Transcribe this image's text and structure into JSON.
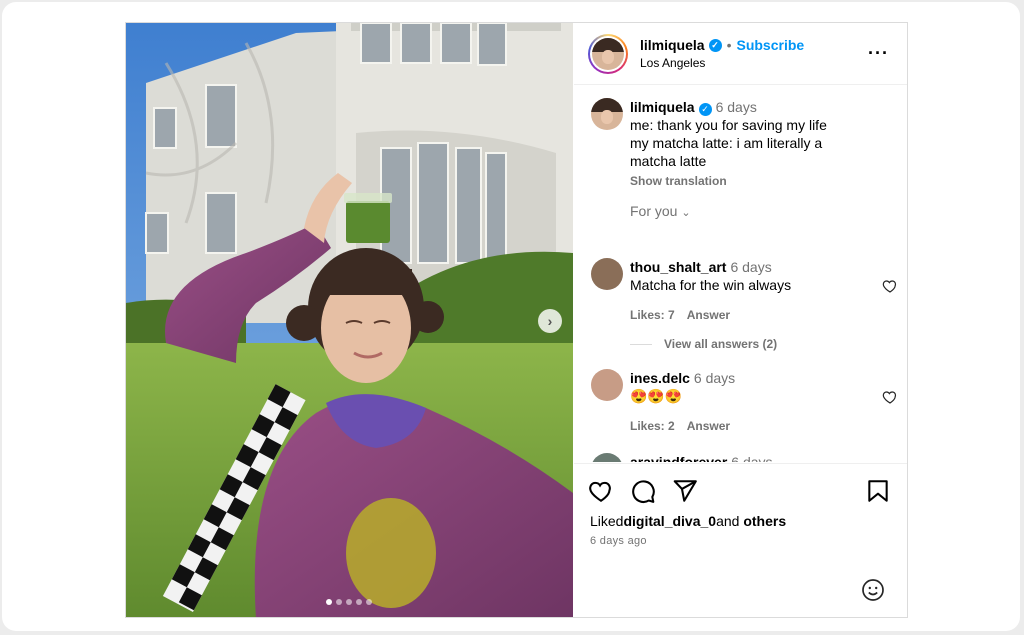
{
  "post": {
    "author": "lilmiquela",
    "subscribe_label": "Subscribe",
    "location": "Los Angeles",
    "caption": {
      "username": "lilmiquela",
      "time": "6 days",
      "text": "me: thank you for saving my life\nmy matcha latte: i am literally a matcha latte",
      "show_translation": "Show translation"
    },
    "filter_label": "For you"
  },
  "comments": [
    {
      "username": "thou_shalt_art",
      "time": "6 days",
      "text": "Matcha for the win always",
      "likes": "Likes: 7",
      "answer": "Answer"
    },
    {
      "username": "ines.delc",
      "time": "6 days",
      "text": "😍😍😍",
      "likes": "Likes: 2",
      "answer": "Answer"
    },
    {
      "username": "aravindforever",
      "time": "6 days",
      "text": "❤️❤️❤️"
    }
  ],
  "view_all": "View all answers (2)",
  "likes_line": {
    "prefix": "Liked",
    "user": "digital_diva_0",
    "and": "and",
    "others": "others"
  },
  "posted_ago": "6 days ago",
  "carousel": {
    "slides": 5,
    "active_index": 0
  },
  "icons": [
    "more-icon",
    "verified-icon",
    "heart-icon",
    "comment-icon",
    "share-icon",
    "bookmark-icon",
    "emoji-icon",
    "chevron-right-icon",
    "chevron-down-icon"
  ],
  "colors": {
    "accent": "#0095f6",
    "muted": "#737373",
    "border": "#dbdbdb"
  }
}
